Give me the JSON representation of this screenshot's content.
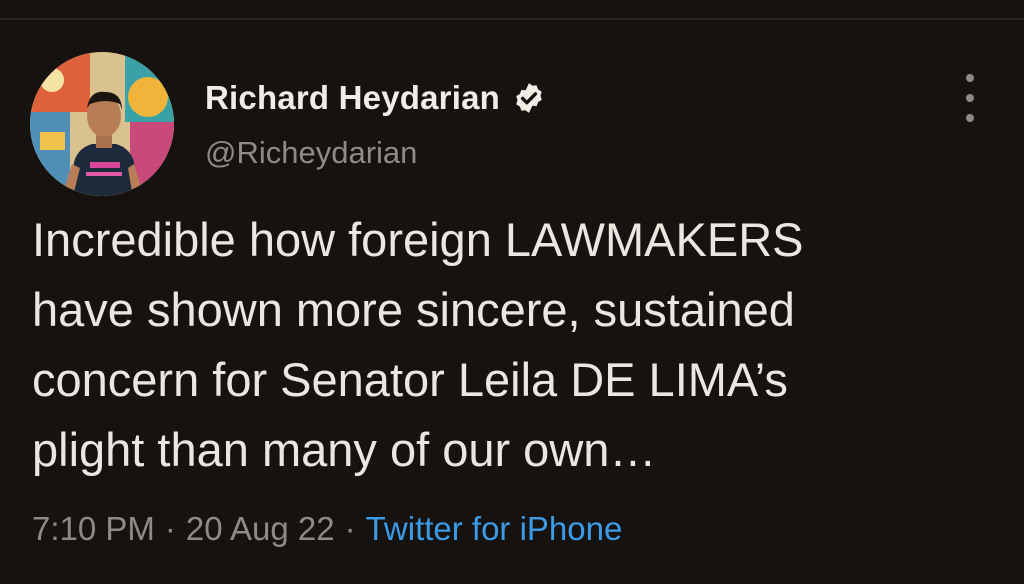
{
  "user": {
    "display_name": "Richard Heydarian",
    "handle": "@Richeydarian",
    "verified_icon": "verified-badge-icon"
  },
  "tweet": {
    "lines": [
      "Incredible how foreign LAWMAKERS",
      "have shown more sincere, sustained",
      "concern for Senator Leila DE LIMA’s",
      "plight than many of our own…"
    ]
  },
  "meta": {
    "time": "7:10 PM",
    "separator": "·",
    "date": "20 Aug 22",
    "source": "Twitter for iPhone"
  },
  "colors": {
    "background": "#161210",
    "text": "#ece6e0",
    "muted": "#8f8a85",
    "link": "#3b9be6"
  },
  "icons": {
    "more": "more-vertical-icon",
    "avatar": "avatar"
  }
}
